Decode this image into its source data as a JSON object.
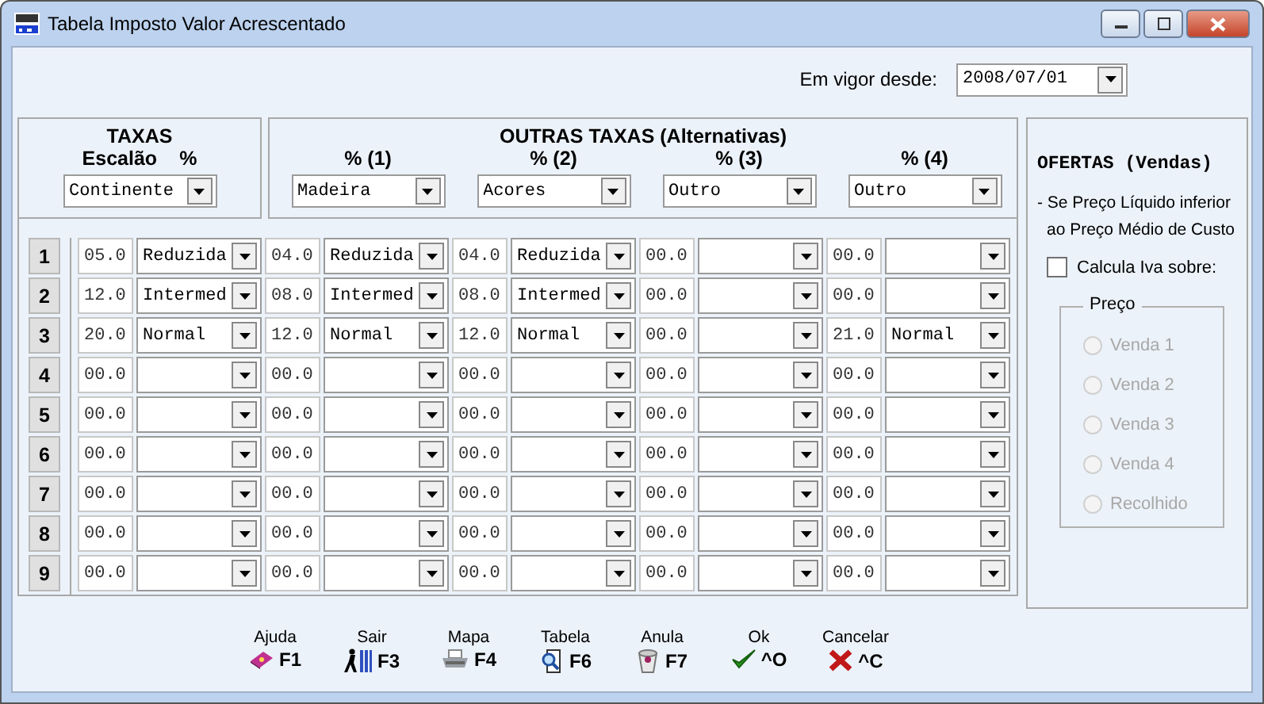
{
  "window": {
    "title": "Tabela Imposto Valor Acrescentado"
  },
  "effective_date": {
    "label": "Em vigor desde:",
    "value": "2008/07/01"
  },
  "taxas": {
    "title": "TAXAS",
    "escalao_label": "Escalão",
    "percent_label": "%",
    "region": "Continente"
  },
  "outras_taxas": {
    "title": "OUTRAS TAXAS (Alternativas)",
    "columns": [
      {
        "label": "% (1)",
        "region": "Madeira"
      },
      {
        "label": "% (2)",
        "region": "Acores"
      },
      {
        "label": "% (3)",
        "region": "Outro"
      },
      {
        "label": "% (4)",
        "region": "Outro"
      }
    ]
  },
  "rows": [
    {
      "number": "1",
      "cells": [
        {
          "rate": "05.0",
          "bracket": "Reduzida"
        },
        {
          "rate": "04.0",
          "bracket": "Reduzida"
        },
        {
          "rate": "04.0",
          "bracket": "Reduzida"
        },
        {
          "rate": "00.0"
        },
        {
          "rate": "00.0"
        }
      ]
    },
    {
      "number": "2",
      "cells": [
        {
          "rate": "12.0",
          "bracket": "Intermed"
        },
        {
          "rate": "08.0",
          "bracket": "Intermed"
        },
        {
          "rate": "08.0",
          "bracket": "Intermed"
        },
        {
          "rate": "00.0"
        },
        {
          "rate": "00.0"
        }
      ]
    },
    {
      "number": "3",
      "cells": [
        {
          "rate": "20.0",
          "bracket": "Normal"
        },
        {
          "rate": "12.0",
          "bracket": "Normal"
        },
        {
          "rate": "12.0",
          "bracket": "Normal"
        },
        {
          "rate": "00.0"
        },
        {
          "rate": "21.0",
          "bracket": "Normal"
        }
      ]
    },
    {
      "number": "4",
      "cells": [
        {
          "rate": "00.0"
        },
        {
          "rate": "00.0"
        },
        {
          "rate": "00.0"
        },
        {
          "rate": "00.0"
        },
        {
          "rate": "00.0"
        }
      ]
    },
    {
      "number": "5",
      "cells": [
        {
          "rate": "00.0"
        },
        {
          "rate": "00.0"
        },
        {
          "rate": "00.0"
        },
        {
          "rate": "00.0"
        },
        {
          "rate": "00.0"
        }
      ]
    },
    {
      "number": "6",
      "cells": [
        {
          "rate": "00.0"
        },
        {
          "rate": "00.0"
        },
        {
          "rate": "00.0"
        },
        {
          "rate": "00.0"
        },
        {
          "rate": "00.0"
        }
      ]
    },
    {
      "number": "7",
      "cells": [
        {
          "rate": "00.0"
        },
        {
          "rate": "00.0"
        },
        {
          "rate": "00.0"
        },
        {
          "rate": "00.0"
        },
        {
          "rate": "00.0"
        }
      ]
    },
    {
      "number": "8",
      "cells": [
        {
          "rate": "00.0"
        },
        {
          "rate": "00.0"
        },
        {
          "rate": "00.0"
        },
        {
          "rate": "00.0"
        },
        {
          "rate": "00.0"
        }
      ]
    },
    {
      "number": "9",
      "cells": [
        {
          "rate": "00.0"
        },
        {
          "rate": "00.0"
        },
        {
          "rate": "00.0"
        },
        {
          "rate": "00.0"
        },
        {
          "rate": "00.0"
        }
      ]
    }
  ],
  "ofertas": {
    "title": "OFERTAS (Vendas)",
    "note_line_1": "- Se Preço Líquido inferior",
    "note_line_2": "ao Preço Médio de Custo",
    "calc_checkbox": {
      "label": "Calcula Iva sobre:",
      "checked": false
    },
    "price_group": {
      "title": "Preço",
      "options": [
        {
          "label": "Venda 1",
          "selected": false,
          "disabled": true
        },
        {
          "label": "Venda 2",
          "selected": false,
          "disabled": true
        },
        {
          "label": "Venda 3",
          "selected": false,
          "disabled": true
        },
        {
          "label": "Venda 4",
          "selected": false,
          "disabled": true
        },
        {
          "label": "Recolhido",
          "selected": false,
          "disabled": true
        }
      ]
    }
  },
  "toolbar": [
    {
      "kind": "help",
      "label": "Ajuda",
      "key": "F1"
    },
    {
      "kind": "exit",
      "label": "Sair",
      "key": "F3"
    },
    {
      "kind": "print",
      "label": "Mapa",
      "key": "F4"
    },
    {
      "kind": "table",
      "label": "Tabela",
      "key": "F6"
    },
    {
      "kind": "undo",
      "label": "Anula",
      "key": "F7"
    },
    {
      "kind": "ok",
      "label": "Ok",
      "key": "^O"
    },
    {
      "kind": "cancel",
      "label": "Cancelar",
      "key": "^C"
    }
  ]
}
